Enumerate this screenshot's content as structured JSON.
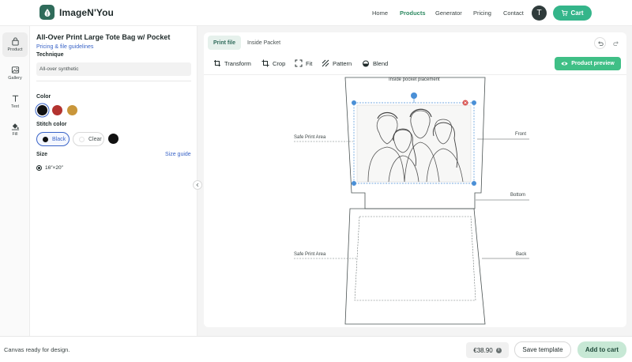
{
  "header": {
    "brand": "ImageN'You",
    "nav": [
      {
        "label": "Home",
        "active": false
      },
      {
        "label": "Products",
        "active": true
      },
      {
        "label": "Generator",
        "active": false
      },
      {
        "label": "Pricing",
        "active": false
      },
      {
        "label": "Contact",
        "active": false
      }
    ],
    "avatar_letter": "T",
    "cart_label": "Cart"
  },
  "rail": [
    {
      "label": "Product",
      "icon": "bag-icon",
      "active": true
    },
    {
      "label": "Gallery",
      "icon": "image-icon",
      "active": false
    },
    {
      "label": "Text",
      "icon": "text-icon",
      "active": false
    },
    {
      "label": "Fill",
      "icon": "fill-bucket-icon",
      "active": false
    }
  ],
  "panel": {
    "title": "All-Over Print Large Tote Bag w/ Pocket",
    "pricing_link": "Pricing & file guidelines",
    "technique_label": "Technique",
    "technique_value": "All-over synthetic",
    "color_label": "Color",
    "colors": [
      {
        "name": "black",
        "hex": "#111111",
        "selected": true
      },
      {
        "name": "red",
        "hex": "#b3332f",
        "selected": false
      },
      {
        "name": "mustard",
        "hex": "#c9963a",
        "selected": false
      }
    ],
    "stitch_label": "Stitch color",
    "stitch_options": [
      {
        "label": "Black",
        "hex": "#111111",
        "selected": true
      },
      {
        "label": "Clear",
        "hex": "#ffffff",
        "selected": false
      }
    ],
    "stitch_swatch_hex": "#111111",
    "size_label": "Size",
    "size_guide": "Size guide",
    "size_value": "16″×20″"
  },
  "workspace": {
    "tabs": [
      "Print file",
      "Inside Packet"
    ],
    "tools": [
      "Transform",
      "Crop",
      "Fit",
      "Pattern",
      "Blend"
    ],
    "preview_label": "Product preview",
    "labels": {
      "inside_pocket": "Inside pocket placement",
      "safe_area_top": "Safe Print Area",
      "safe_area_bottom": "Safe Print Area",
      "front": "Front",
      "bottom": "Bottom",
      "back": "Back"
    }
  },
  "footer": {
    "status": "Canvas ready for design.",
    "price": "€38.90",
    "save_label": "Save template",
    "add_label": "Add to cart"
  },
  "colors": {
    "accent": "#34b58a",
    "link": "#3a64c7",
    "handle": "#4a8fd6",
    "delete": "#d9534f"
  }
}
